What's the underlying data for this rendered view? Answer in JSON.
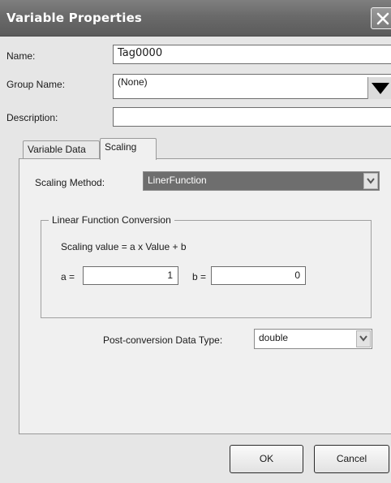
{
  "window": {
    "title": "Variable Properties"
  },
  "fields": {
    "name_label": "Name:",
    "name_value": "Tag0000",
    "group_label": "Group Name:",
    "group_value": "(None)",
    "description_label": "Description:",
    "description_value": ""
  },
  "tabs": [
    {
      "label": "Variable Data",
      "active": false
    },
    {
      "label": "Scaling",
      "active": true
    }
  ],
  "scaling": {
    "method_label": "Scaling Method:",
    "method_value": "LinerFunction",
    "group_title": "Linear Function Conversion",
    "formula": "Scaling value = a x Value + b",
    "a_label": "a =",
    "a_value": "1",
    "b_label": "b =",
    "b_value": "0",
    "post_label": "Post-conversion Data Type:",
    "post_value": "double"
  },
  "buttons": {
    "ok": "OK",
    "cancel": "Cancel"
  },
  "colors": {
    "titlebar": "#6a6a6a",
    "dialog_bg": "#e6e6e6",
    "highlight": "#6e6e6e"
  },
  "icons": {
    "close": "close-icon",
    "dropdown": "chevron-down-icon",
    "group_dropdown": "triangle-down-icon"
  }
}
